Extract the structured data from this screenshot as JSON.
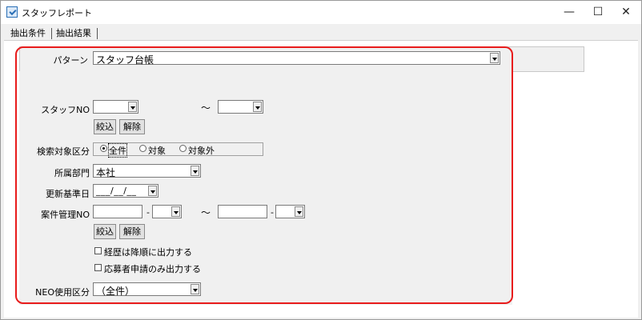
{
  "window": {
    "title": "スタッフレポート",
    "minimize": "—",
    "maximize": "☐",
    "close": "✕"
  },
  "tabs": [
    {
      "label": "抽出条件"
    },
    {
      "label": "抽出結果"
    }
  ],
  "pattern": {
    "label": "パターン",
    "value": "スタッフ台帳"
  },
  "staff_no": {
    "label": "スタッフNO",
    "from": "",
    "to": "",
    "tilde": "～",
    "filter_button": "絞込",
    "clear_button": "解除"
  },
  "search_target": {
    "label": "検索対象区分",
    "options": [
      "全件",
      "対象",
      "対象外"
    ],
    "selected": "全件"
  },
  "department": {
    "label": "所属部門",
    "value": "本社"
  },
  "update_date": {
    "label": "更新基準日",
    "value": "___/__/__"
  },
  "case_no": {
    "label": "案件管理NO",
    "dash": "-",
    "tilde": "～",
    "filter_button": "絞込",
    "clear_button": "解除"
  },
  "checkboxes": [
    {
      "label": "経歴は降順に出力する",
      "checked": false
    },
    {
      "label": "応募者申請のみ出力する",
      "checked": false
    }
  ],
  "neo_usage": {
    "label": "NEO使用区分",
    "value": "（全件）"
  }
}
